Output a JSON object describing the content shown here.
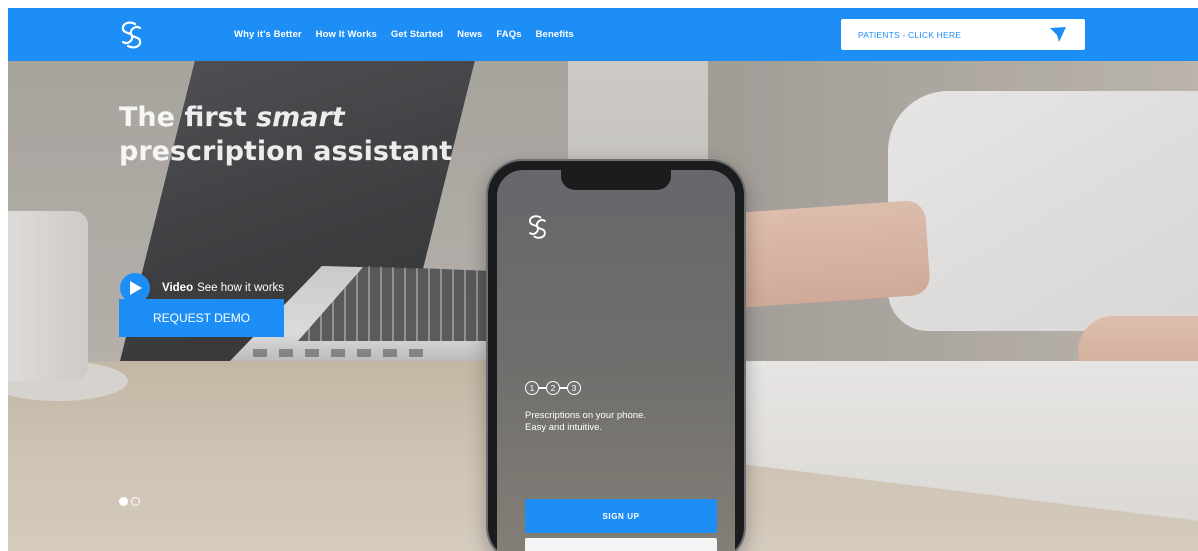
{
  "header": {
    "logo_icon": "s-logo-icon",
    "nav": [
      {
        "label": "Why it's Better"
      },
      {
        "label": "How It Works"
      },
      {
        "label": "Get Started"
      },
      {
        "label": "News"
      },
      {
        "label": "FAQs"
      },
      {
        "label": "Benefits"
      }
    ],
    "patients_cta": {
      "label": "PATIENTS - CLICK HERE",
      "icon": "send-arrow-icon"
    },
    "colors": {
      "brand": "#1c8ef5",
      "white": "#ffffff"
    }
  },
  "hero": {
    "title_line1_plain": "The first ",
    "title_line1_em": "smart",
    "title_line2": "prescription assistant",
    "video_label": "Video",
    "video_sub": "See how it works",
    "demo_label": "REQUEST DEMO",
    "carousel": {
      "count": 2,
      "active_index": 0
    }
  },
  "phone": {
    "steps": [
      "1",
      "2",
      "3"
    ],
    "text_line1": "Prescriptions on your phone.",
    "text_line2": "Easy and intuitive.",
    "signup_label": "SIGN UP"
  }
}
